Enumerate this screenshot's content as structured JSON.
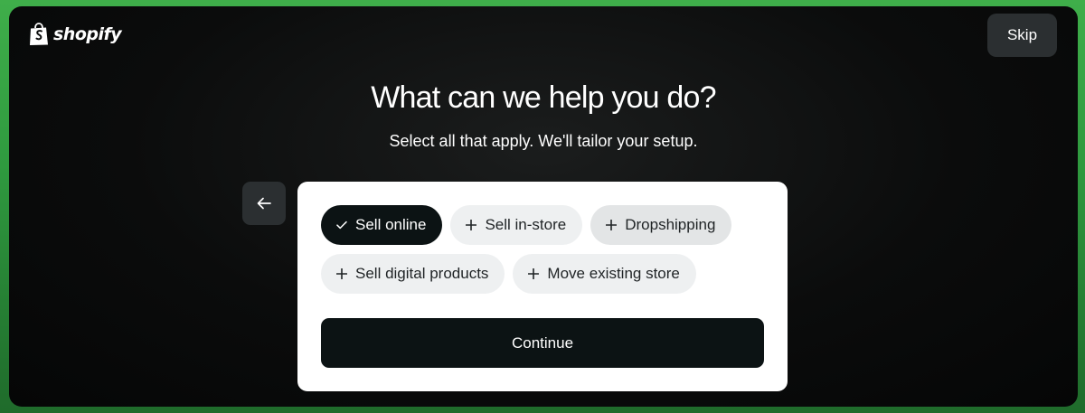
{
  "brand": {
    "name": "shopify",
    "logo_icon": "shopify-bag-icon"
  },
  "header": {
    "skip_label": "Skip"
  },
  "main": {
    "title": "What can we help you do?",
    "subtitle": "Select all that apply. We'll tailor your setup.",
    "back_icon": "arrow-left-icon"
  },
  "options": [
    {
      "label": "Sell online",
      "selected": true,
      "icon": "check-icon"
    },
    {
      "label": "Sell in-store",
      "selected": false,
      "icon": "plus-icon"
    },
    {
      "label": "Dropshipping",
      "selected": false,
      "icon": "plus-icon"
    },
    {
      "label": "Sell digital products",
      "selected": false,
      "icon": "plus-icon"
    },
    {
      "label": "Move existing store",
      "selected": false,
      "icon": "plus-icon"
    }
  ],
  "footer": {
    "continue_label": "Continue"
  },
  "colors": {
    "outer_background": "#3fae4a",
    "panel_background": "#0b0c0c",
    "card_background": "#ffffff",
    "selected_chip": "#0c1314",
    "unselected_chip": "#eef0f1",
    "button_dark": "#2b2f31"
  }
}
